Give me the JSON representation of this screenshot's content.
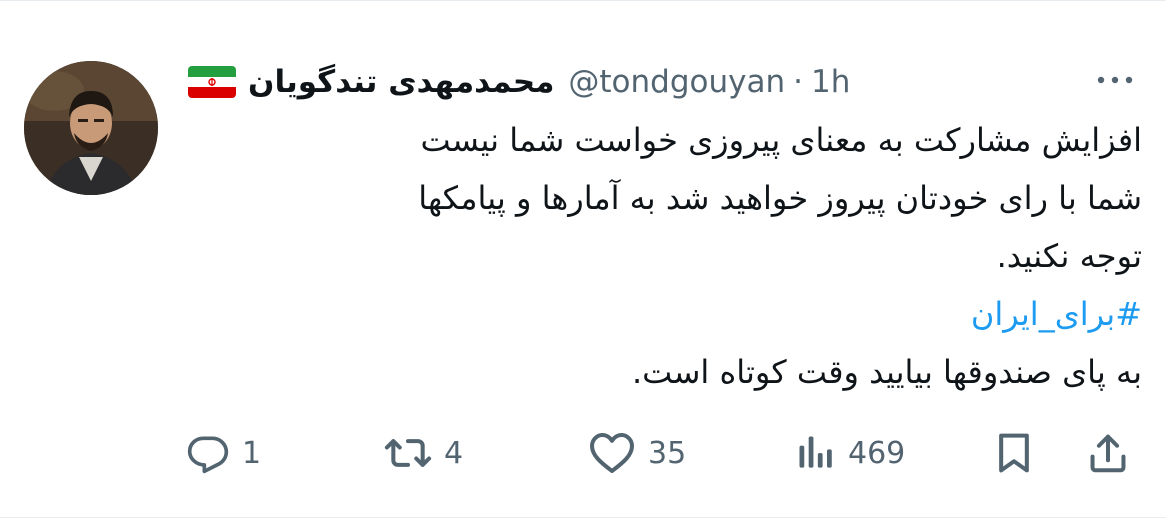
{
  "tweet": {
    "display_name": "محمدمهدی تندگویان",
    "handle": "@tondgouyan",
    "separator": "·",
    "time": "1h",
    "lines": [
      "افزایش مشارکت به معنای پیروزی خواست شما نیست",
      "شما با رای خودتان پیروز خواهید شد به آمارها و پیامکها",
      "توجه نکنید."
    ],
    "hashtag": "#برای_ایران",
    "last_line": "به پای صندوقها بیایید وقت کوتاه است."
  },
  "icons": {
    "flag": "iran-flag-icon",
    "more": "more-options-icon",
    "reply": "reply-icon",
    "retweet": "retweet-icon",
    "like": "like-icon",
    "views": "views-icon",
    "bookmark": "bookmark-icon",
    "share": "share-icon"
  },
  "metrics": {
    "replies": "1",
    "retweets": "4",
    "likes": "35",
    "views": "469"
  },
  "colors": {
    "text": "#0f1419",
    "muted": "#536471",
    "link": "#1d9bf0"
  }
}
